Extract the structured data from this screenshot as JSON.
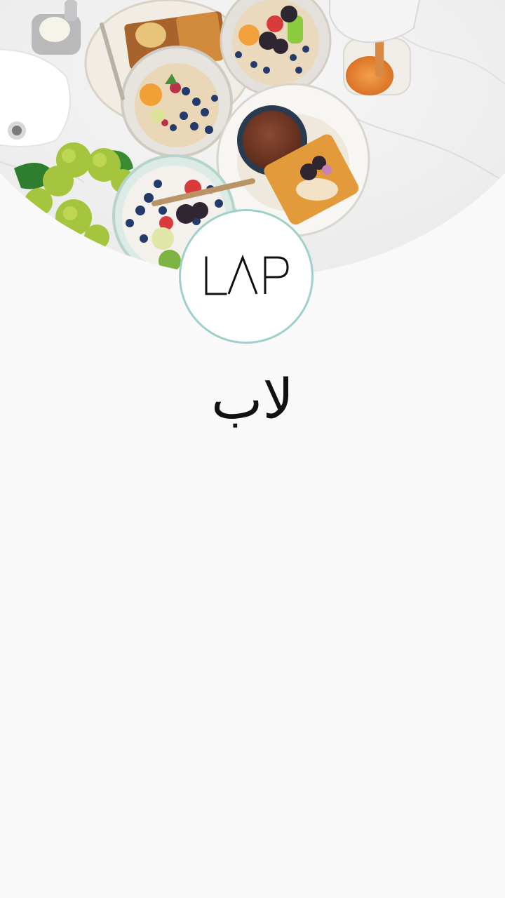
{
  "logo": {
    "text": "LAP",
    "border_color": "#9fd0cc"
  },
  "brand": {
    "name": "لاب"
  },
  "hero": {
    "image_description_icon": "breakfast-table-photo",
    "background_color": "#f1f1f1"
  }
}
